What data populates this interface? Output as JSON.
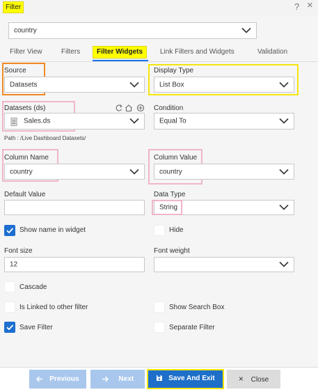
{
  "header": {
    "title": "Filter",
    "help_icon": "?",
    "close_icon": "×"
  },
  "filter_select": {
    "value": "country"
  },
  "tabs": [
    {
      "label": "Filter View",
      "active": false
    },
    {
      "label": "Filters",
      "active": false
    },
    {
      "label": "Filter Widgets",
      "active": true
    },
    {
      "label": "Link Filters and Widgets",
      "active": false
    },
    {
      "label": "Validation",
      "active": false
    }
  ],
  "source": {
    "label": "Source",
    "value": "Datasets"
  },
  "display_type": {
    "label": "Display Type",
    "value": "List Box"
  },
  "datasets": {
    "label": "Datasets (ds)",
    "value": "Sales.ds",
    "path": "Path : /Live Dashboard Datasets/"
  },
  "condition": {
    "label": "Condition",
    "value": "Equal To"
  },
  "column_name": {
    "label": "Column Name",
    "value": "country"
  },
  "column_value": {
    "label": "Column Value",
    "value": "country"
  },
  "default_value": {
    "label": "Default Value",
    "value": ""
  },
  "data_type": {
    "label": "Data Type",
    "value": "String"
  },
  "show_name": {
    "label": "Show name in widget",
    "checked": true
  },
  "hide": {
    "label": "Hide",
    "checked": false
  },
  "font_size": {
    "label": "Font size",
    "value": "12"
  },
  "font_weight": {
    "label": "Font weight",
    "value": ""
  },
  "cascade": {
    "label": "Cascade",
    "checked": false
  },
  "is_linked": {
    "label": "Is Linked to other filter",
    "checked": false
  },
  "show_search_box": {
    "label": "Show Search Box",
    "checked": false
  },
  "save_filter": {
    "label": "Save Filter",
    "checked": true
  },
  "separate_filter": {
    "label": "Separate Filter",
    "checked": false
  },
  "footer": {
    "previous": "Previous",
    "next": "Next",
    "save_and_exit": "Save And Exit",
    "close": "Close"
  },
  "colors": {
    "accent": "#1d6fc9",
    "checkbox_on": "#1e6fd0",
    "disabled_button": "#a9c7ec",
    "highlight_yellow": "#ffff00",
    "highlight_orange": "#f08a24",
    "highlight_pink": "#f0b6c9"
  }
}
